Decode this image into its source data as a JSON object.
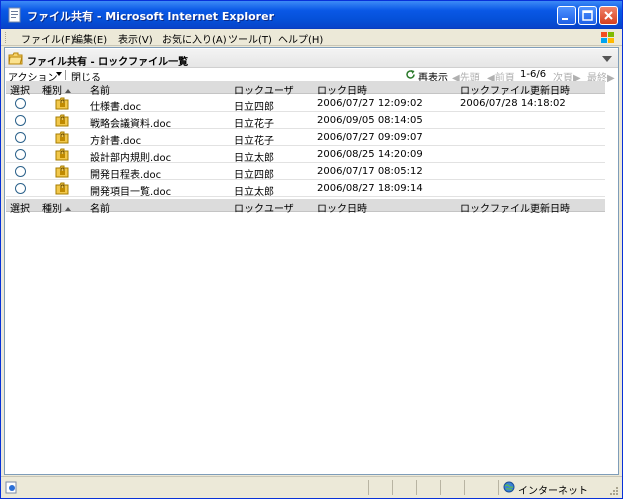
{
  "window": {
    "title": "ファイル共有 - Microsoft Internet Explorer"
  },
  "menubar": {
    "file": "ファイル(F)",
    "edit": "編集(E)",
    "view": "表示(V)",
    "favorites": "お気に入り(A)",
    "tools": "ツール(T)",
    "help": "ヘルプ(H)"
  },
  "page": {
    "title": "ファイル共有 - ロックファイル一覧"
  },
  "toolbar": {
    "action_label": "アクション",
    "close_label": "閉じる",
    "refresh_label": "再表示",
    "nav_first": "先頭",
    "nav_prev": "前頁",
    "nav_range": "1-6/6",
    "nav_next": "次頁",
    "nav_last": "最終"
  },
  "table": {
    "headers": {
      "select": "選択",
      "kind": "種別",
      "name": "名前",
      "lock_user": "ロックユーザ",
      "lock_date": "ロック日時",
      "updated": "ロックファイル更新日時"
    },
    "rows": [
      {
        "name": "仕様書.doc",
        "lock_user": "日立四郎",
        "lock_date": "2006/07/27 12:09:02",
        "updated": "2006/07/28 14:18:02"
      },
      {
        "name": "戦略会議資料.doc",
        "lock_user": "日立花子",
        "lock_date": "2006/09/05 08:14:05",
        "updated": ""
      },
      {
        "name": "方針書.doc",
        "lock_user": "日立花子",
        "lock_date": "2006/07/27 09:09:07",
        "updated": ""
      },
      {
        "name": "設計部内規則.doc",
        "lock_user": "日立太郎",
        "lock_date": "2006/08/25 14:20:09",
        "updated": ""
      },
      {
        "name": "開発日程表.doc",
        "lock_user": "日立四郎",
        "lock_date": "2006/07/17 08:05:12",
        "updated": ""
      },
      {
        "name": "開発項目一覧.doc",
        "lock_user": "日立太郎",
        "lock_date": "2006/08/27 18:09:14",
        "updated": ""
      }
    ]
  },
  "statusbar": {
    "zone": "インターネット"
  },
  "icons": {
    "app": "ie-page-icon",
    "folder": "folder-icon",
    "file": "locked-folder-icon",
    "refresh": "refresh-icon",
    "zone": "globe-icon"
  },
  "colors": {
    "titlebar": "#0a58e6",
    "header_bg": "#dcdcdc",
    "disabled_nav": "#b0b0b0"
  }
}
